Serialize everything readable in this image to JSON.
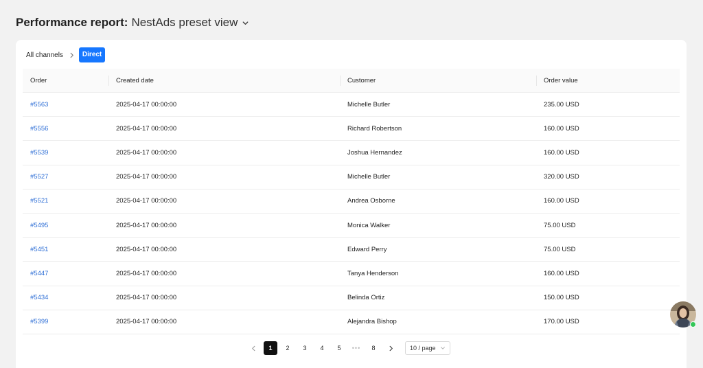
{
  "header": {
    "title": "Performance report:",
    "view_name": "NestAds preset view"
  },
  "breadcrumb": {
    "parent": "All channels",
    "current": "Direct"
  },
  "table": {
    "columns": [
      "Order",
      "Created date",
      "Customer",
      "Order value"
    ],
    "rows": [
      {
        "order": "#5563",
        "created": "2025-04-17 00:00:00",
        "customer": "Michelle Butler",
        "value": "235.00 USD"
      },
      {
        "order": "#5556",
        "created": "2025-04-17 00:00:00",
        "customer": "Richard Robertson",
        "value": "160.00 USD"
      },
      {
        "order": "#5539",
        "created": "2025-04-17 00:00:00",
        "customer": "Joshua Hernandez",
        "value": "160.00 USD"
      },
      {
        "order": "#5527",
        "created": "2025-04-17 00:00:00",
        "customer": "Michelle Butler",
        "value": "320.00 USD"
      },
      {
        "order": "#5521",
        "created": "2025-04-17 00:00:00",
        "customer": "Andrea Osborne",
        "value": "160.00 USD"
      },
      {
        "order": "#5495",
        "created": "2025-04-17 00:00:00",
        "customer": "Monica Walker",
        "value": "75.00 USD"
      },
      {
        "order": "#5451",
        "created": "2025-04-17 00:00:00",
        "customer": "Edward Perry",
        "value": "75.00 USD"
      },
      {
        "order": "#5447",
        "created": "2025-04-17 00:00:00",
        "customer": "Tanya Henderson",
        "value": "160.00 USD"
      },
      {
        "order": "#5434",
        "created": "2025-04-17 00:00:00",
        "customer": "Belinda Ortiz",
        "value": "150.00 USD"
      },
      {
        "order": "#5399",
        "created": "2025-04-17 00:00:00",
        "customer": "Alejandra Bishop",
        "value": "170.00 USD"
      }
    ]
  },
  "pagination": {
    "pages": [
      "1",
      "2",
      "3",
      "4",
      "5",
      "•••",
      "8"
    ],
    "current": "1",
    "page_size": "10 / page"
  },
  "icons": {
    "header_dropdown": "chevron-down-icon",
    "breadcrumb_separator": "chevron-right-icon",
    "prev": "chevron-left-icon",
    "next": "chevron-right-icon",
    "avatar": "user-avatar"
  },
  "colors": {
    "accent": "#1677ff",
    "link": "#2f6fd6",
    "online": "#35c759",
    "active_page": "#111111"
  }
}
